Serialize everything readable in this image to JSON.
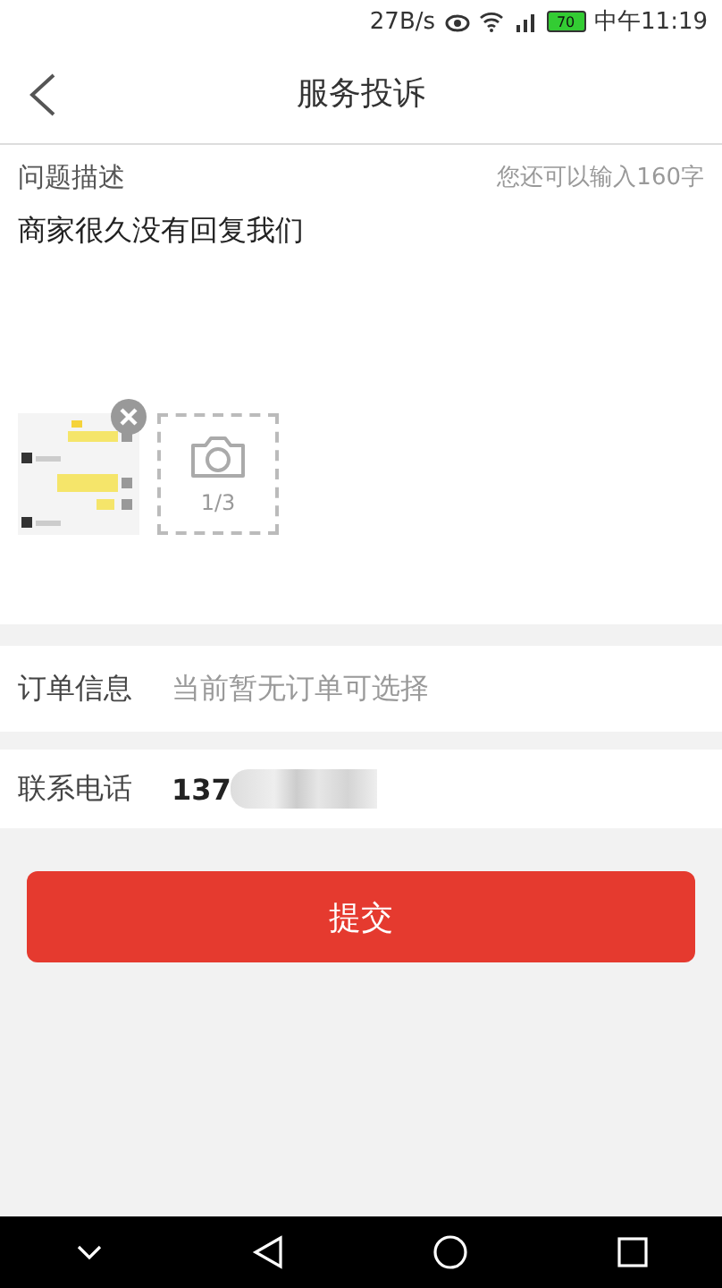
{
  "status_bar": {
    "speed": "27B/s",
    "battery": "70",
    "time": "中午11:19"
  },
  "header": {
    "title": "服务投诉"
  },
  "description": {
    "label": "问题描述",
    "remaining": "您还可以输入160字",
    "value": "商家很久没有回复我们",
    "add_photo": {
      "counter": "1/3"
    }
  },
  "order": {
    "label": "订单信息",
    "placeholder": "当前暂无订单可选择"
  },
  "phone": {
    "label": "联系电话",
    "value": "137"
  },
  "submit": {
    "label": "提交"
  }
}
